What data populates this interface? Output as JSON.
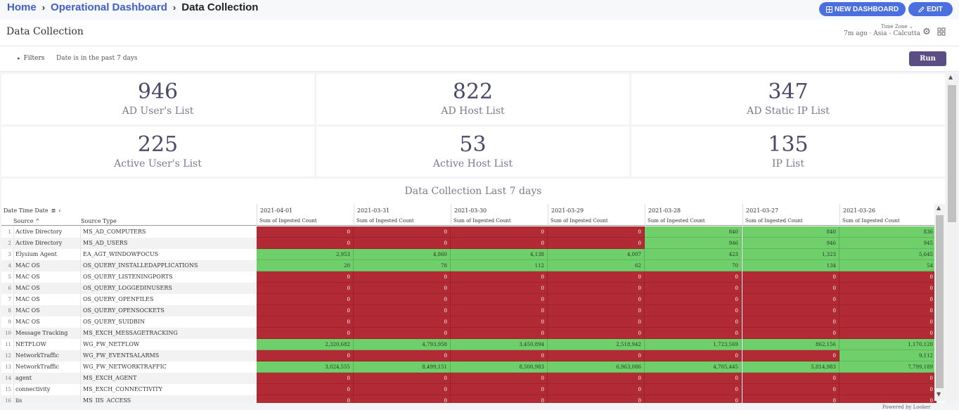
{
  "breadcrumb": {
    "home": "Home",
    "dashboard": "Operational Dashboard",
    "current": "Data Collection",
    "sep1": "›",
    "sep2": "›"
  },
  "toolbar": {
    "new_dashboard_label": "NEW DASHBOARD",
    "edit_label": "EDIT"
  },
  "header": {
    "title": "Data Collection",
    "updated": "7m ago",
    "separator": "·",
    "timezone_label": "Time Zone",
    "timezone": "Asia - Calcutta"
  },
  "filters": {
    "toggle_label": "Filters",
    "summary": "Date is in the past 7 days",
    "run_label": "Run"
  },
  "tiles": [
    {
      "value": "946",
      "label": "AD User's List"
    },
    {
      "value": "822",
      "label": "AD Host List"
    },
    {
      "value": "347",
      "label": "AD Static IP List"
    },
    {
      "value": "225",
      "label": "Active User's List"
    },
    {
      "value": "53",
      "label": "Active Host List"
    },
    {
      "value": "135",
      "label": "IP List"
    }
  ],
  "table": {
    "title": "Data Collection Last 7 days",
    "pivot_label": "Date Time Date",
    "col_source": "Source",
    "col_source_type": "Source Type",
    "measure": "Sum of Ingested Count",
    "dates": [
      "2021-04-01",
      "2021-03-31",
      "2021-03-30",
      "2021-03-29",
      "2021-03-28",
      "2021-03-27",
      "2021-03-26"
    ],
    "rows": [
      {
        "num": "1",
        "source": "Active Directory",
        "type": "MS_AD_COMPUTERS",
        "values": [
          "0",
          "0",
          "0",
          "0",
          "840",
          "840",
          "836"
        ],
        "status": [
          "r",
          "r",
          "r",
          "r",
          "g",
          "g",
          "g"
        ]
      },
      {
        "num": "2",
        "source": "Active Directory",
        "type": "MS_AD_USERS",
        "values": [
          "0",
          "0",
          "0",
          "0",
          "946",
          "946",
          "945"
        ],
        "status": [
          "r",
          "r",
          "r",
          "r",
          "g",
          "g",
          "g"
        ]
      },
      {
        "num": "3",
        "source": "Elysium Agent",
        "type": "EA_AGT_WINDOWFOCUS",
        "values": [
          "2,953",
          "4,860",
          "4,138",
          "4,007",
          "423",
          "1,323",
          "5,645"
        ],
        "status": [
          "g",
          "g",
          "g",
          "g",
          "g",
          "g",
          "g"
        ]
      },
      {
        "num": "4",
        "source": "MAC OS",
        "type": "OS_QUERY_INSTALLEDAPPLICATIONS",
        "values": [
          "20",
          "78",
          "112",
          "62",
          "70",
          "134",
          "54"
        ],
        "status": [
          "g",
          "g",
          "g",
          "g",
          "g",
          "g",
          "g"
        ]
      },
      {
        "num": "5",
        "source": "MAC OS",
        "type": "OS_QUERY_LISTENINGPORTS",
        "values": [
          "0",
          "0",
          "0",
          "0",
          "0",
          "0",
          "0"
        ],
        "status": [
          "r",
          "r",
          "r",
          "r",
          "r",
          "r",
          "r"
        ]
      },
      {
        "num": "6",
        "source": "MAC OS",
        "type": "OS_QUERY_LOGGEDINUSERS",
        "values": [
          "0",
          "0",
          "0",
          "0",
          "0",
          "0",
          "0"
        ],
        "status": [
          "r",
          "r",
          "r",
          "r",
          "r",
          "r",
          "r"
        ]
      },
      {
        "num": "7",
        "source": "MAC OS",
        "type": "OS_QUERY_OPENFILES",
        "values": [
          "0",
          "0",
          "0",
          "0",
          "0",
          "0",
          "0"
        ],
        "status": [
          "r",
          "r",
          "r",
          "r",
          "r",
          "r",
          "r"
        ]
      },
      {
        "num": "8",
        "source": "MAC OS",
        "type": "OS_QUERY_OPENSOCKETS",
        "values": [
          "0",
          "0",
          "0",
          "0",
          "0",
          "0",
          "0"
        ],
        "status": [
          "r",
          "r",
          "r",
          "r",
          "r",
          "r",
          "r"
        ]
      },
      {
        "num": "9",
        "source": "MAC OS",
        "type": "OS_QUERY_SUIDBIN",
        "values": [
          "0",
          "0",
          "0",
          "0",
          "0",
          "0",
          "0"
        ],
        "status": [
          "r",
          "r",
          "r",
          "r",
          "r",
          "r",
          "r"
        ]
      },
      {
        "num": "10",
        "source": "Message Tracking",
        "type": "MS_EXCH_MESSAGETRACKING",
        "values": [
          "0",
          "0",
          "0",
          "0",
          "0",
          "0",
          "0"
        ],
        "status": [
          "r",
          "r",
          "r",
          "r",
          "r",
          "r",
          "r"
        ]
      },
      {
        "num": "11",
        "source": "NETFLOW",
        "type": "WG_FW_NETFLOW",
        "values": [
          "2,320,682",
          "4,793,958",
          "3,450,894",
          "2,518,942",
          "1,723,569",
          "862,156",
          "1,170,120"
        ],
        "status": [
          "g",
          "g",
          "g",
          "g",
          "g",
          "g",
          "g"
        ]
      },
      {
        "num": "12",
        "source": "NetworkTraffic",
        "type": "WG_FW_EVENTSALARMS",
        "values": [
          "0",
          "0",
          "0",
          "0",
          "0",
          "0",
          "9,112"
        ],
        "status": [
          "r",
          "r",
          "r",
          "r",
          "r",
          "r",
          "g"
        ]
      },
      {
        "num": "13",
        "source": "NetworkTraffic",
        "type": "WG_FW_NETWORKTRAFFIC",
        "values": [
          "3,024,555",
          "8,499,151",
          "8,500,983",
          "6,963,086",
          "4,705,445",
          "5,814,983",
          "7,799,189"
        ],
        "status": [
          "g",
          "g",
          "g",
          "g",
          "g",
          "g",
          "g"
        ]
      },
      {
        "num": "14",
        "source": "agent",
        "type": "MS_EXCH_AGENT",
        "values": [
          "0",
          "0",
          "0",
          "0",
          "0",
          "0",
          "0"
        ],
        "status": [
          "r",
          "r",
          "r",
          "r",
          "r",
          "r",
          "r"
        ]
      },
      {
        "num": "15",
        "source": "connectivity",
        "type": "MS_EXCH_CONNECTIVITY",
        "values": [
          "0",
          "0",
          "0",
          "0",
          "0",
          "0",
          "0"
        ],
        "status": [
          "r",
          "r",
          "r",
          "r",
          "r",
          "r",
          "r"
        ]
      },
      {
        "num": "16",
        "source": "iis",
        "type": "MS_IIS_ACCESS",
        "values": [
          "0",
          "0",
          "0",
          "0",
          "0",
          "0",
          "0"
        ],
        "status": [
          "r",
          "r",
          "r",
          "r",
          "r",
          "r",
          "r"
        ]
      }
    ]
  },
  "footer": {
    "powered_by": "Powered by Looker"
  },
  "colors": {
    "accent": "#4b6fde",
    "run": "#5b4e84",
    "bad": "#b12a34",
    "good": "#6fcf6a"
  }
}
